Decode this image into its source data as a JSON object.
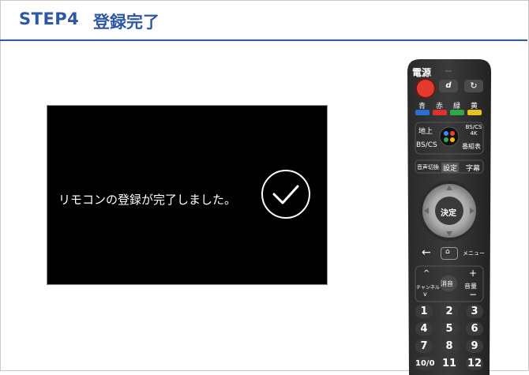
{
  "header": {
    "step": "STEP4",
    "title": "登録完了"
  },
  "screen": {
    "message": "リモコンの登録が完了しました。"
  },
  "remote": {
    "power_label": "電源",
    "d_label": "d",
    "colors": [
      {
        "label": "青",
        "hex": "#2a6fd6"
      },
      {
        "label": "赤",
        "hex": "#e03030"
      },
      {
        "label": "緑",
        "hex": "#2fa84a"
      },
      {
        "label": "黄",
        "hex": "#e8c21e"
      }
    ],
    "chijo": "地上",
    "bscs4k": "BS/CS 4K",
    "bscs": "BS/CS",
    "bangumihyo": "番組表",
    "onsei": "音声切換",
    "settei": "設定",
    "jimaku": "字幕",
    "kettei": "決定",
    "menu": "メニュー",
    "channel": "チャンネル",
    "shoon": "消音",
    "onryo": "音量",
    "numbers": [
      "1",
      "2",
      "3",
      "4",
      "5",
      "6",
      "7",
      "8",
      "9",
      "10/0",
      "11",
      "12"
    ]
  }
}
